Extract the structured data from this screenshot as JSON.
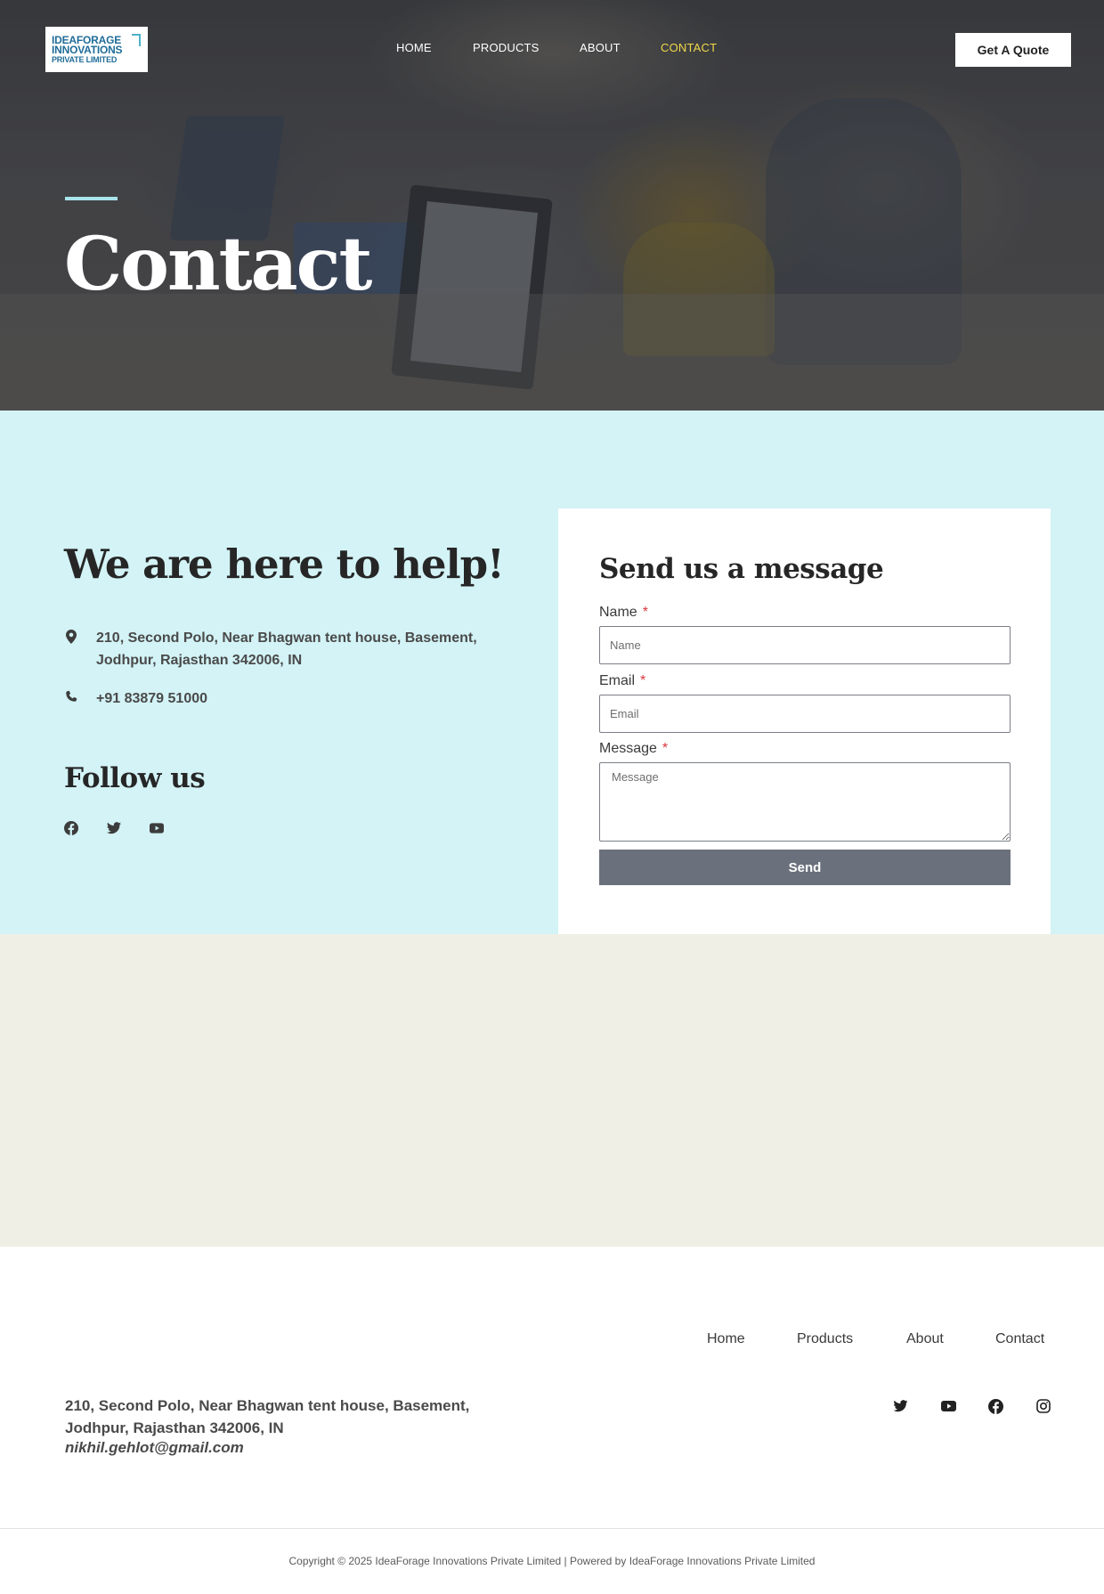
{
  "header": {
    "logo": {
      "line1": "IDEAFORAGE",
      "line2": "INNOVATIONS",
      "line3": "PRIVATE LIMITED"
    },
    "nav": [
      {
        "label": "HOME",
        "active": false
      },
      {
        "label": "PRODUCTS",
        "active": false
      },
      {
        "label": "ABOUT",
        "active": false
      },
      {
        "label": "CONTACT",
        "active": true
      }
    ],
    "quote_button": "Get A Quote",
    "active_color": "#f0d84a"
  },
  "hero": {
    "title": "Contact",
    "accent_color": "#a8e3ec"
  },
  "contact": {
    "heading": "We are here to help!",
    "address_line1": "210, Second Polo, Near Bhagwan tent house, Basement,",
    "address_line2": "Jodhpur, Rajasthan 342006, IN",
    "phone": "+91 83879 51000",
    "follow_heading": "Follow us",
    "social_icons": [
      "facebook-icon",
      "twitter-icon",
      "youtube-icon"
    ],
    "section_bg": "#d3f3f6"
  },
  "form": {
    "title": "Send us a message",
    "name_label": "Name",
    "name_placeholder": "Name",
    "email_label": "Email",
    "email_placeholder": "Email",
    "message_label": "Message",
    "message_placeholder": "Message",
    "required_mark": "*",
    "send_label": "Send",
    "button_color": "#6b717c"
  },
  "footer": {
    "nav": [
      "Home",
      "Products",
      "About",
      "Contact"
    ],
    "address_line1": "210, Second Polo, Near Bhagwan tent house, Basement,",
    "address_line2": "Jodhpur, Rajasthan 342006, IN",
    "email": "nikhil.gehlot@gmail.com",
    "social_icons": [
      "twitter-icon",
      "youtube-icon",
      "facebook-icon",
      "instagram-icon"
    ],
    "copyright": "Copyright © 2025 IdeaForage Innovations Private Limited | Powered by IdeaForage Innovations Private Limited"
  }
}
